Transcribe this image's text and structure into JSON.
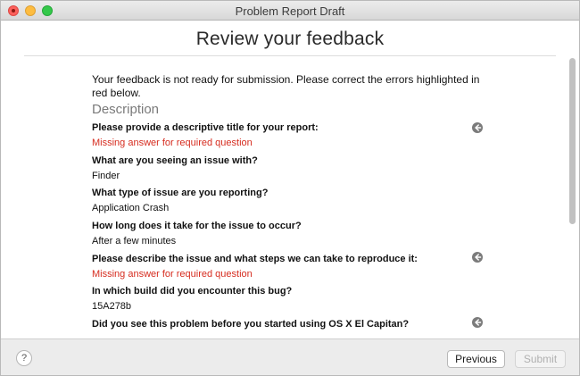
{
  "window": {
    "title": "Problem Report Draft"
  },
  "header": {
    "title": "Review your feedback"
  },
  "intro": "Your feedback is not ready for submission. Please correct the errors highlighted in red below.",
  "section": {
    "title": "Description"
  },
  "questions": [
    {
      "question": "Please provide a descriptive title for your report:",
      "answer": "Missing answer for required question",
      "error": true
    },
    {
      "question": "What are you seeing an issue with?",
      "answer": "Finder",
      "error": false
    },
    {
      "question": "What type of issue are you reporting?",
      "answer": "Application Crash",
      "error": false
    },
    {
      "question": "How long does it take for the issue to occur?",
      "answer": "After a few minutes",
      "error": false
    },
    {
      "question": "Please describe the issue and what steps we can take to reproduce it:",
      "answer": "Missing answer for required question",
      "error": true
    },
    {
      "question": "In which build did you encounter this bug?",
      "answer": "15A278b",
      "error": false
    },
    {
      "question": "Did you see this problem before you started using OS X El Capitan?",
      "answer": "",
      "error": true
    }
  ],
  "footer": {
    "help_label": "?",
    "previous_label": "Previous",
    "submit_label": "Submit"
  },
  "colors": {
    "error": "#d62c1f",
    "accent_close": "#fc605c",
    "accent_min": "#fdbc40",
    "accent_max": "#34c84a"
  },
  "icons": {
    "go_to_question": "arrow-circle-left-icon",
    "help": "question-mark-icon"
  }
}
